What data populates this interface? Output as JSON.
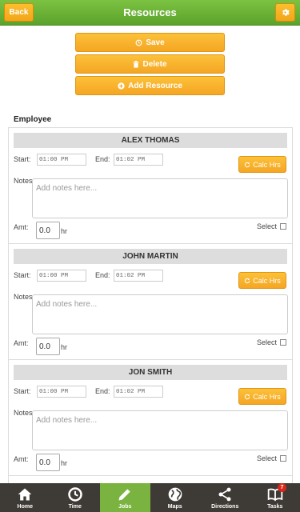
{
  "header": {
    "title": "Resources",
    "back_label": "Back",
    "settings_icon": "gear-icon"
  },
  "actions": {
    "save_label": "Save",
    "delete_label": "Delete",
    "add_label": "Add Resource"
  },
  "employee_label": "Employee",
  "employees": [
    {
      "name": "ALEX THOMAS",
      "start_label": "Start:",
      "start_value": "01:00 PM",
      "end_label": "End:",
      "end_value": "01:02 PM",
      "calc_label": "Calc Hrs",
      "notes_label": "Notes",
      "notes_placeholder": "Add notes here...",
      "amt_label": "Amt:",
      "amt_value": "0.0",
      "hr_label": "hr",
      "select_label": "Select"
    },
    {
      "name": "JOHN MARTIN",
      "start_label": "Start:",
      "start_value": "01:00 PM",
      "end_label": "End:",
      "end_value": "01:02 PM",
      "calc_label": "Calc Hrs",
      "notes_label": "Notes",
      "notes_placeholder": "Add notes here...",
      "amt_label": "Amt:",
      "amt_value": "0.0",
      "hr_label": "hr",
      "select_label": "Select"
    },
    {
      "name": "JON SMITH",
      "start_label": "Start:",
      "start_value": "01:00 PM",
      "end_label": "End:",
      "end_value": "01:02 PM",
      "calc_label": "Calc Hrs",
      "notes_label": "Notes",
      "notes_placeholder": "Add notes here...",
      "amt_label": "Amt:",
      "amt_value": "0.0",
      "hr_label": "hr",
      "select_label": "Select"
    }
  ],
  "nav": {
    "items": [
      {
        "label": "Home",
        "icon": "home-icon"
      },
      {
        "label": "Time",
        "icon": "clock-icon"
      },
      {
        "label": "Jobs",
        "icon": "pencil-icon",
        "active": true
      },
      {
        "label": "Maps",
        "icon": "globe-icon"
      },
      {
        "label": "Directions",
        "icon": "share-icon"
      },
      {
        "label": "Tasks",
        "icon": "book-icon",
        "badge": "7"
      }
    ]
  },
  "colors": {
    "header_green": "#6bb535",
    "button_orange": "#f7b02a",
    "nav_dark": "#3e3a35",
    "nav_active": "#7ab33f",
    "badge_red": "#d9271c"
  }
}
